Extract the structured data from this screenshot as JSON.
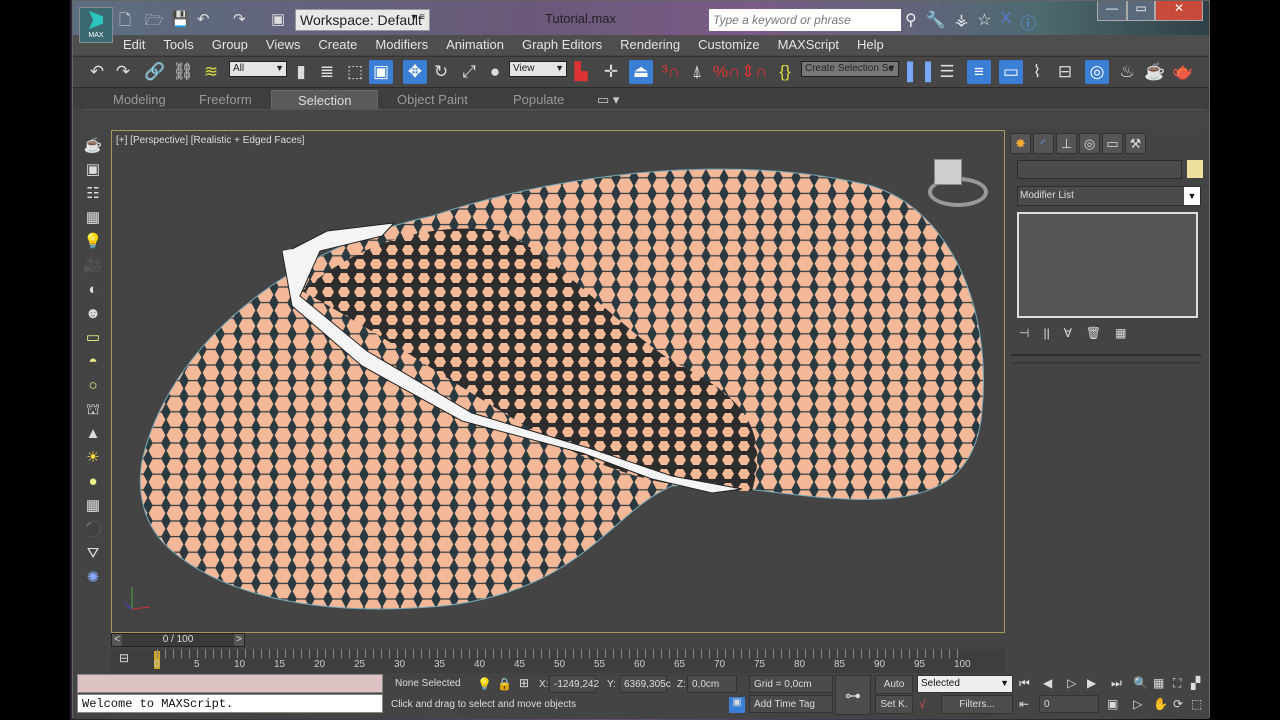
{
  "title": {
    "logo": "MAX",
    "workspace": "Workspace: Default",
    "file": "Tutorial.max",
    "search_placeholder": "Type a keyword or phrase"
  },
  "menu": [
    "Edit",
    "Tools",
    "Group",
    "Views",
    "Create",
    "Modifiers",
    "Animation",
    "Graph Editors",
    "Rendering",
    "Customize",
    "MAXScript",
    "Help"
  ],
  "toolbar": {
    "filter": "All",
    "ref_coord": "View",
    "selection_set": "Create Selection Se"
  },
  "ribbon_tabs": [
    "Modeling",
    "Freeform",
    "Selection",
    "Object Paint",
    "Populate"
  ],
  "ribbon_active": "Selection",
  "viewport": {
    "label": "[+] [Perspective] [Realistic + Edged Faces]"
  },
  "command_panel": {
    "modifier_list": "Modifier List"
  },
  "timeline": {
    "frame": "0 / 100",
    "ticks": [
      "0",
      "5",
      "10",
      "15",
      "20",
      "25",
      "30",
      "35",
      "40",
      "45",
      "50",
      "55",
      "60",
      "65",
      "70",
      "75",
      "80",
      "85",
      "90",
      "95",
      "100"
    ]
  },
  "status": {
    "maxscript_output": "Welcome to MAXScript.",
    "selection": "None Selected",
    "x_label": "X:",
    "x": "-1249,242",
    "y_label": "Y:",
    "y": "6369,305c",
    "z_label": "Z:",
    "z": "0,0cm",
    "grid": "Grid = 0,0cm",
    "prompt": "Click and drag to select and move objects",
    "add_time_tag": "Add Time Tag",
    "auto": "Auto",
    "set_key": "Set K.",
    "key_filter": "Selected",
    "filters": "Filters...",
    "current_frame": "0"
  },
  "colors": {
    "mesh": "#f2b898",
    "viewport_bg": "#444444",
    "accent": "#3b7ed6"
  }
}
